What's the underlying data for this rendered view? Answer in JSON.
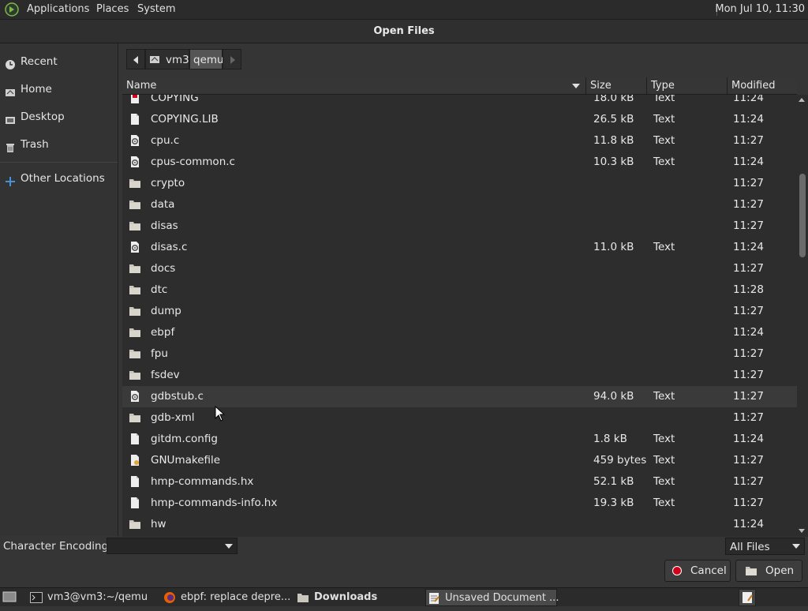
{
  "top_panel": {
    "menus": [
      "Applications",
      "Places",
      "System"
    ],
    "clock": "Mon Jul 10, 11:30"
  },
  "dialog": {
    "title": "Open Files"
  },
  "sidebar": {
    "items": [
      {
        "label": "Recent",
        "icon": "recent-icon"
      },
      {
        "label": "Home",
        "icon": "home-icon"
      },
      {
        "label": "Desktop",
        "icon": "desktop-icon"
      },
      {
        "label": "Trash",
        "icon": "trash-icon"
      }
    ],
    "other": {
      "label": "Other Locations",
      "icon": "plus-icon"
    }
  },
  "pathbar": {
    "segments": [
      "vm3",
      "qemu"
    ]
  },
  "columns": {
    "name": "Name",
    "size": "Size",
    "type": "Type",
    "modified": "Modified"
  },
  "files": [
    {
      "name": "COPYING",
      "size": "18.0 kB",
      "type": "Text",
      "modified": "11:24",
      "icon": "text-file-icon"
    },
    {
      "name": "COPYING.LIB",
      "size": "26.5 kB",
      "type": "Text",
      "modified": "11:24",
      "icon": "text-file-icon"
    },
    {
      "name": "cpu.c",
      "size": "11.8 kB",
      "type": "Text",
      "modified": "11:27",
      "icon": "c-source-icon"
    },
    {
      "name": "cpus-common.c",
      "size": "10.3 kB",
      "type": "Text",
      "modified": "11:24",
      "icon": "c-source-icon"
    },
    {
      "name": "crypto",
      "size": "",
      "type": "",
      "modified": "11:27",
      "icon": "folder-icon"
    },
    {
      "name": "data",
      "size": "",
      "type": "",
      "modified": "11:27",
      "icon": "folder-icon"
    },
    {
      "name": "disas",
      "size": "",
      "type": "",
      "modified": "11:27",
      "icon": "folder-icon"
    },
    {
      "name": "disas.c",
      "size": "11.0 kB",
      "type": "Text",
      "modified": "11:24",
      "icon": "c-source-icon"
    },
    {
      "name": "docs",
      "size": "",
      "type": "",
      "modified": "11:27",
      "icon": "folder-icon"
    },
    {
      "name": "dtc",
      "size": "",
      "type": "",
      "modified": "11:28",
      "icon": "folder-icon"
    },
    {
      "name": "dump",
      "size": "",
      "type": "",
      "modified": "11:27",
      "icon": "folder-icon"
    },
    {
      "name": "ebpf",
      "size": "",
      "type": "",
      "modified": "11:24",
      "icon": "folder-icon"
    },
    {
      "name": "fpu",
      "size": "",
      "type": "",
      "modified": "11:27",
      "icon": "folder-icon"
    },
    {
      "name": "fsdev",
      "size": "",
      "type": "",
      "modified": "11:27",
      "icon": "folder-icon"
    },
    {
      "name": "gdbstub.c",
      "size": "94.0 kB",
      "type": "Text",
      "modified": "11:27",
      "icon": "c-source-icon",
      "highlight": true
    },
    {
      "name": "gdb-xml",
      "size": "",
      "type": "",
      "modified": "11:27",
      "icon": "folder-icon"
    },
    {
      "name": "gitdm.config",
      "size": "1.8 kB",
      "type": "Text",
      "modified": "11:24",
      "icon": "text-file-icon"
    },
    {
      "name": "GNUmakefile",
      "size": "459 bytes",
      "type": "Text",
      "modified": "11:27",
      "icon": "makefile-icon"
    },
    {
      "name": "hmp-commands.hx",
      "size": "52.1 kB",
      "type": "Text",
      "modified": "11:27",
      "icon": "text-file-icon"
    },
    {
      "name": "hmp-commands-info.hx",
      "size": "19.3 kB",
      "type": "Text",
      "modified": "11:27",
      "icon": "text-file-icon"
    },
    {
      "name": "hw",
      "size": "",
      "type": "",
      "modified": "11:24",
      "icon": "folder-icon"
    }
  ],
  "bottom": {
    "encoding_label": "Character Encoding:",
    "encoding_value": "",
    "filter_value": "All Files",
    "cancel_label": "Cancel",
    "open_label": "Open"
  },
  "taskbar": {
    "items": [
      {
        "label": "vm3@vm3:~/qemu",
        "icon": "terminal-icon",
        "bold": false
      },
      {
        "label": "ebpf: replace depre...",
        "icon": "firefox-icon",
        "bold": false
      },
      {
        "label": "Downloads",
        "icon": "folder-icon",
        "bold": true
      },
      {
        "label": "Unsaved Document ...",
        "icon": "text-editor-icon",
        "bold": false
      }
    ]
  },
  "colors": {
    "accent_red": "#d0021b",
    "folder": "#c9c6bd"
  }
}
